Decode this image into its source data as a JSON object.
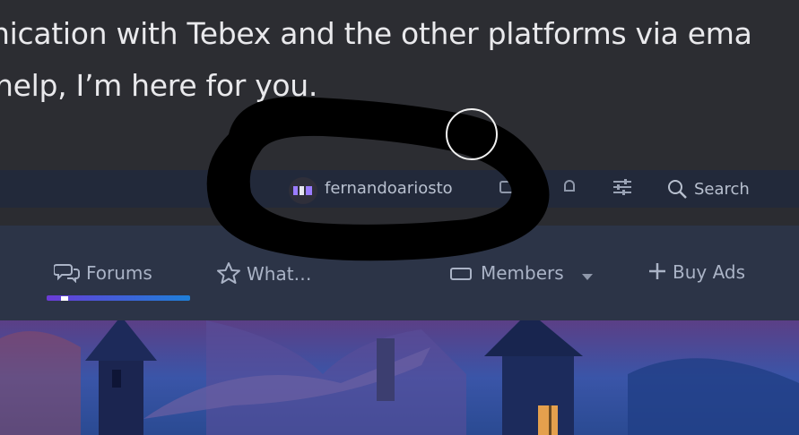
{
  "message": {
    "lines": [
      "",
      "nication with Tebex and the other platforms via ema",
      " help, I’m here for you."
    ]
  },
  "user_bar": {
    "username": "fernandoariosto",
    "search_label": "Search"
  },
  "nav": {
    "items": [
      {
        "label": "Forums",
        "active": true
      },
      {
        "label": "What…"
      },
      {
        "label": "Members"
      },
      {
        "label": "Buy Ads"
      }
    ]
  },
  "colors": {
    "accent_gradient_start": "#6c3bd6",
    "accent_gradient_end": "#1e7fd8",
    "nav_bg": "#2c3447",
    "user_bar_bg": "#22293a"
  },
  "icons": [
    "forums-icon",
    "star-icon",
    "members-icon",
    "plus-icon",
    "search-icon",
    "filter-icon",
    "bell-icon",
    "mail-icon"
  ]
}
